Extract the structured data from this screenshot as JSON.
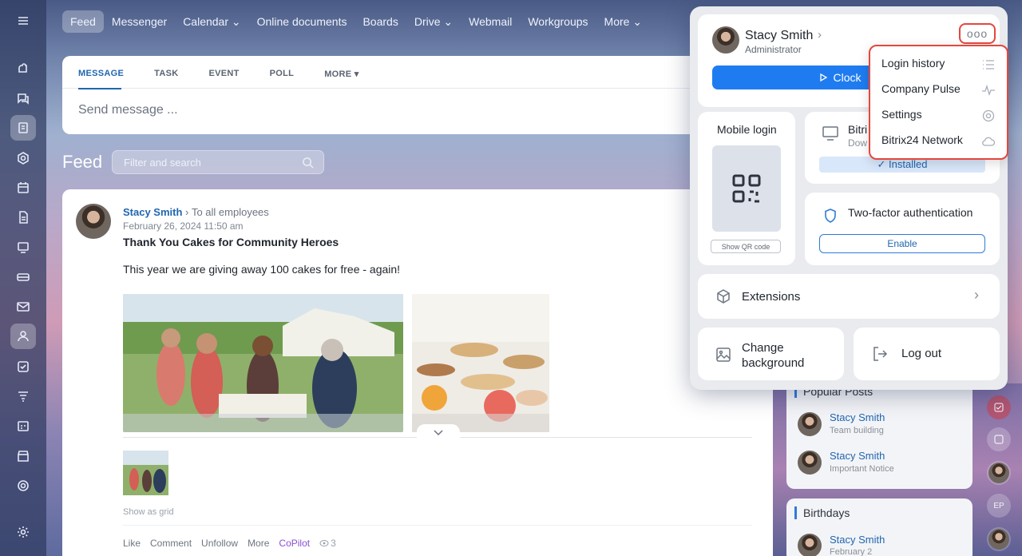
{
  "topnav": [
    "Feed",
    "Messenger",
    "Calendar ⌄",
    "Online documents",
    "Boards",
    "Drive ⌄",
    "Webmail",
    "Workgroups",
    "More ⌄"
  ],
  "composer": {
    "tabs": [
      "MESSAGE",
      "TASK",
      "EVENT",
      "POLL",
      "MORE ▾"
    ],
    "placeholder": "Send message ..."
  },
  "feed": {
    "title": "Feed",
    "filter_placeholder": "Filter and search"
  },
  "post": {
    "author": "Stacy Smith",
    "audience": "To all employees",
    "date": "February 26, 2024 11:50 am",
    "title": "Thank You Cakes for Community Heroes",
    "text": "This year we are giving away 100 cakes for free - again!",
    "show_grid": "Show as grid",
    "actions": [
      "Like",
      "Comment",
      "Unfollow",
      "More"
    ],
    "copilot": "CoPilot",
    "views": "3"
  },
  "popular": {
    "title": "Popular Posts",
    "items": [
      {
        "name": "Stacy Smith",
        "sub": "Team building"
      },
      {
        "name": "Stacy Smith",
        "sub": "Important Notice"
      }
    ]
  },
  "birthdays": {
    "title": "Birthdays",
    "name": "Stacy Smith",
    "date": "February 2"
  },
  "rail_initials": "EP",
  "profile": {
    "name": "Stacy Smith",
    "role": "Administrator",
    "dots": "ooo",
    "clock_label": "Clock",
    "mobile_login": "Mobile login",
    "show_qr": "Show QR code",
    "bitrix_title": "Bitri",
    "bitrix_sub": "Dow",
    "installed": "✓ Installed",
    "twofa_title": "Two-factor authentication",
    "enable": "Enable",
    "extensions": "Extensions",
    "change_bg": "Change background",
    "logout": "Log out"
  },
  "menu": [
    "Login history",
    "Company Pulse",
    "Settings",
    "Bitrix24 Network"
  ],
  "colors": {
    "accent": "#1f7cf0",
    "highlight": "#e4473e",
    "link": "#2066b0"
  }
}
